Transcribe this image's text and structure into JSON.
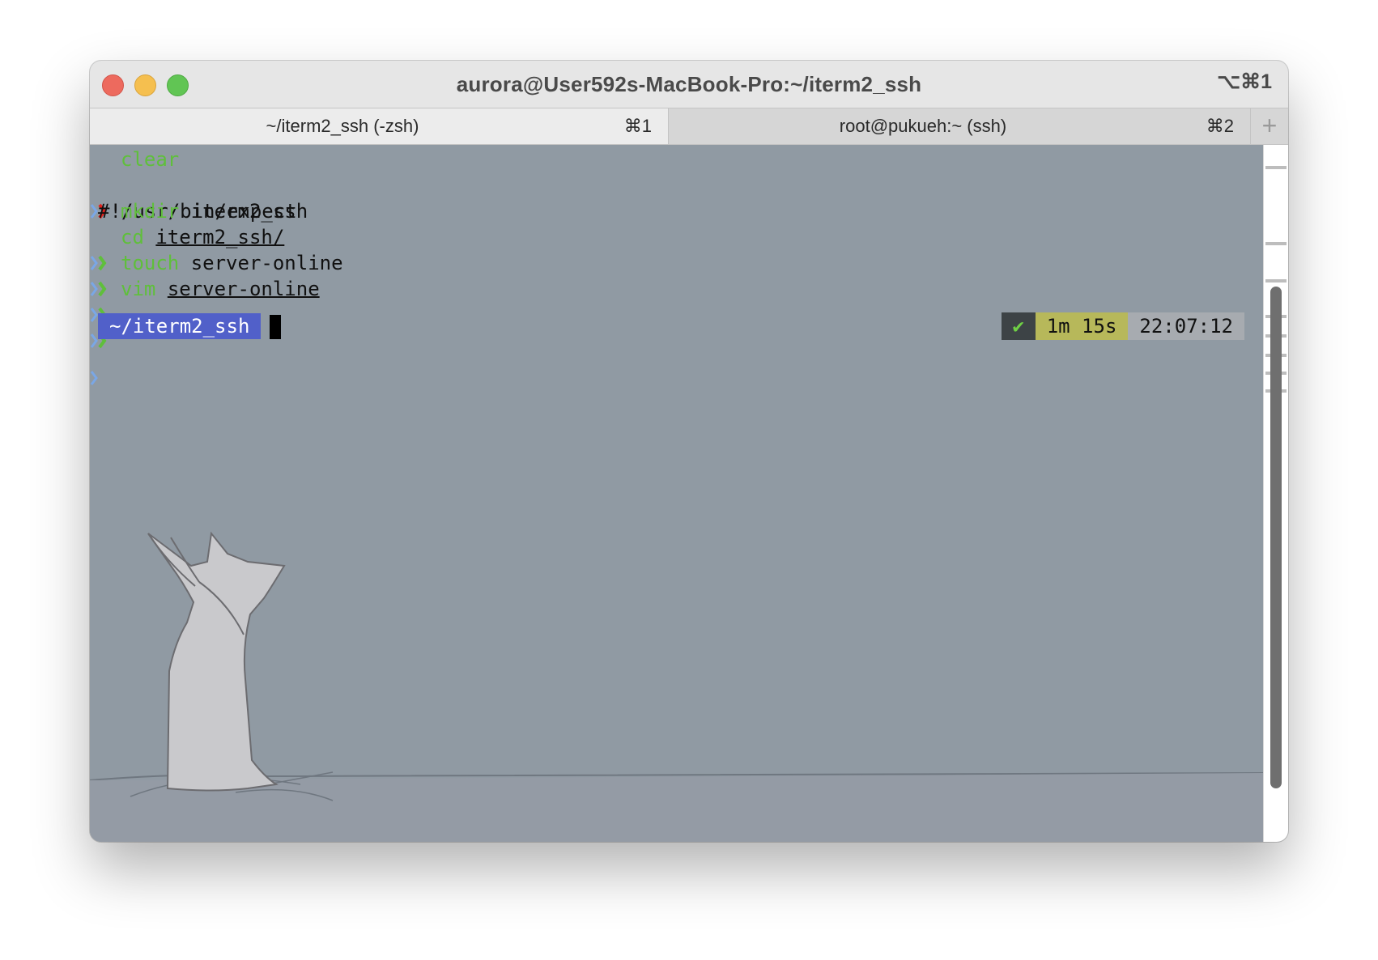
{
  "window": {
    "title": "aurora@User592s-MacBook-Pro:~/iterm2_ssh",
    "title_shortcut": "⌥⌘1"
  },
  "tabs": [
    {
      "label": "~/iterm2_ssh (-zsh)",
      "shortcut": "⌘1",
      "active": true
    },
    {
      "label": "root@pukueh:~ (ssh)",
      "shortcut": "⌘2",
      "active": false
    }
  ],
  "new_tab_symbol": "+",
  "terminal": {
    "lines": [
      {
        "cmd": "clear",
        "args": ""
      },
      {
        "output": "#!/usr/bin/expect"
      },
      {
        "cmd": "mkdir",
        "args": "iterm2_ssh"
      },
      {
        "cmd": "cd",
        "args": "iterm2_ssh/"
      },
      {
        "cmd": "touch",
        "args": "server-online"
      },
      {
        "cmd": "vim",
        "args": "server-online"
      }
    ],
    "prompt_dir": "~/iterm2_ssh",
    "right_prompt": {
      "status": "✔",
      "duration": "1m 15s",
      "time": "22:07:12"
    }
  },
  "colors": {
    "terminal_bg": "#909aa3",
    "command_green": "#5fbf3b",
    "prompt_dir_bg": "#5160c9",
    "error_arrow": "#e0201b",
    "ok_arrow": "#5fbf3b",
    "duration_bg": "#b7b85a"
  },
  "background_image": "cat-illustration"
}
